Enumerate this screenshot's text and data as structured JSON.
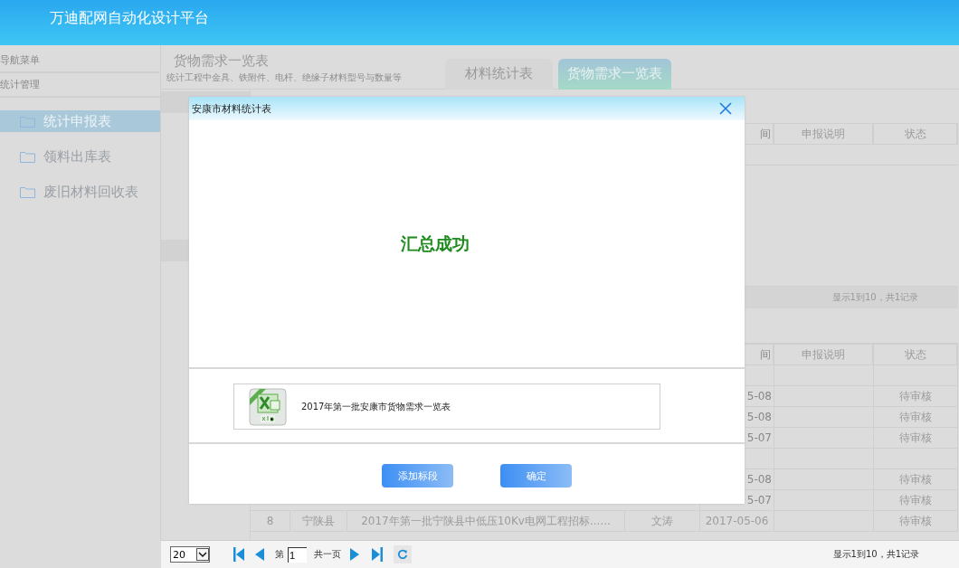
{
  "header": {
    "title": "万迪配网自动化设计平台"
  },
  "sidebar": {
    "heading": "导航菜单",
    "section": "统计管理",
    "items": [
      {
        "label": "统计申报表",
        "selected": true
      },
      {
        "label": "领料出库表",
        "selected": false
      },
      {
        "label": "废旧材料回收表",
        "selected": false
      }
    ]
  },
  "page": {
    "title": "货物需求一览表",
    "subtitle": "统计工程中金具、铁附件、电杆、绝缘子材料型号与数量等"
  },
  "tabs": [
    {
      "label": "材料统计表",
      "selected": false
    },
    {
      "label": "货物需求一览表",
      "selected": true
    }
  ],
  "upper_table": {
    "columns": [
      "间",
      "申报说明",
      "状态"
    ],
    "rows": [
      {
        "kind": "group"
      }
    ],
    "footer": "显示1到10，共1记录"
  },
  "lower_table": {
    "columns": [
      "间",
      "申报说明",
      "状态"
    ],
    "rows": [
      {
        "kind": "group"
      },
      {
        "kind": "partial",
        "time": "5-08",
        "status": "待审核"
      },
      {
        "kind": "partial",
        "time": "5-08",
        "status": "待审核"
      },
      {
        "kind": "partial",
        "time": "5-07",
        "status": "待审核"
      },
      {
        "kind": "group"
      },
      {
        "kind": "partial",
        "time": "5-08",
        "status": "待审核"
      },
      {
        "kind": "partial",
        "time": "5-07",
        "status": "待审核"
      },
      {
        "kind": "full",
        "number": "8",
        "county": "宁陕县",
        "name": "2017年第一批宁陕县中低压10Kv电网工程招标......",
        "person": "文涛",
        "time": "2017-05-06",
        "status": "待审核"
      }
    ]
  },
  "dialog": {
    "title": "安康市材料统计表",
    "message": "汇总成功",
    "file": {
      "name": "2017年第一批安康市货物需求一览表"
    },
    "buttons": [
      "添加标段",
      "确定"
    ]
  },
  "pager": {
    "page_size": "20",
    "page_label": "第",
    "page": "1",
    "total": "共一页",
    "summary": "显示1到10，共1记录"
  }
}
